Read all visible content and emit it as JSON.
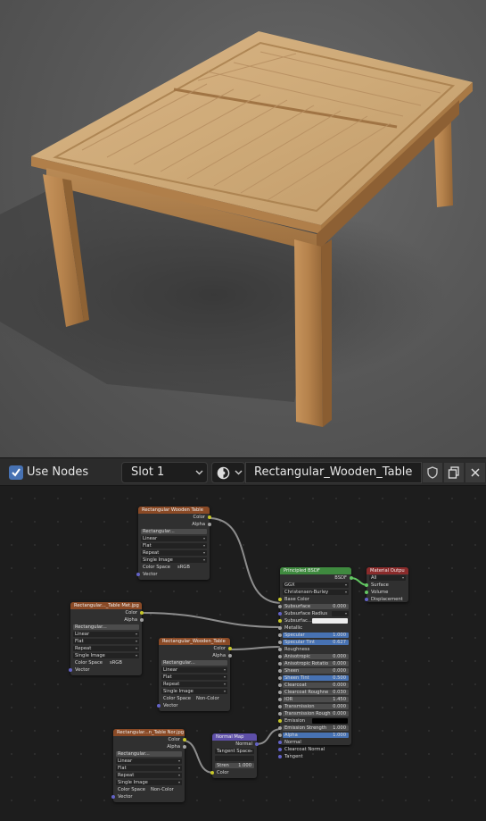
{
  "header": {
    "use_nodes_label": "Use Nodes",
    "use_nodes_checked": true,
    "slot_label": "Slot 1",
    "material_name": "Rectangular_Wooden_Table"
  },
  "colors": {
    "accent": "#4772b3",
    "image_node_header": "#8a4a26",
    "bsdf_node_header": "#3f8a3f",
    "output_node_header": "#8a2b2b",
    "normal_map_header": "#5e4fa8"
  },
  "nodes": {
    "tex1": {
      "title": "Rectangular Wooden Table",
      "out_color": "Color",
      "out_alpha": "Alpha",
      "image": "Rectangular...",
      "interp": "Linear",
      "proj": "Flat",
      "ext": "Repeat",
      "source": "Single Image",
      "cs_label": "Color Space",
      "cs_value": "sRGB",
      "in_vector": "Vector"
    },
    "tex2": {
      "title": "Rectangular..._Table Met.jpg",
      "out_color": "Color",
      "out_alpha": "Alpha",
      "image": "Rectangular...",
      "interp": "Linear",
      "proj": "Flat",
      "ext": "Repeat",
      "source": "Single Image",
      "cs_label": "Color Space",
      "cs_value": "sRGB",
      "in_vector": "Vector"
    },
    "tex3": {
      "title": "Rectangular_Wooden_Table",
      "out_color": "Color",
      "out_alpha": "Alpha",
      "image": "Rectangular...",
      "interp": "Linear",
      "proj": "Flat",
      "ext": "Repeat",
      "source": "Single Image",
      "cs_label": "Color Space",
      "cs_value": "Non-Color",
      "in_vector": "Vector"
    },
    "tex4": {
      "title": "Rectangular...n_Table Nor.jpg",
      "out_color": "Color",
      "out_alpha": "Alpha",
      "image": "Rectangular...",
      "interp": "Linear",
      "proj": "Flat",
      "ext": "Repeat",
      "source": "Single Image",
      "cs_label": "Color Space",
      "cs_value": "Non-Color",
      "in_vector": "Vector"
    },
    "normal_map": {
      "title": "Normal Map",
      "out_normal": "Normal",
      "space": "Tangent Space",
      "strength_label": "Stren",
      "strength_value": "1.000",
      "in_color": "Color"
    },
    "bsdf": {
      "title": "Principled BSDF",
      "out_bsdf": "BSDF",
      "distribution": "GGX",
      "subsurface_method": "Christensen-Burley",
      "rows": [
        {
          "label": "Base Color",
          "kind": "socket"
        },
        {
          "label": "Subsurface",
          "value": "0.000",
          "kind": "field"
        },
        {
          "label": "Subsurface Radius",
          "kind": "dropdown"
        },
        {
          "label": "Subsurfac...",
          "kind": "color"
        },
        {
          "label": "Metallic",
          "kind": "socket"
        },
        {
          "label": "Specular",
          "value": "1.000",
          "kind": "blue"
        },
        {
          "label": "Specular Tint",
          "value": "0.627",
          "kind": "blue"
        },
        {
          "label": "Roughness",
          "kind": "socket"
        },
        {
          "label": "Anisotropic",
          "value": "0.000",
          "kind": "field"
        },
        {
          "label": "Anisotropic Rotatio",
          "value": "0.000",
          "kind": "field"
        },
        {
          "label": "Sheen",
          "value": "0.000",
          "kind": "field"
        },
        {
          "label": "Sheen Tint",
          "value": "0.500",
          "kind": "blue"
        },
        {
          "label": "Clearcoat",
          "value": "0.000",
          "kind": "field"
        },
        {
          "label": "Clearcoat Roughne",
          "value": "0.030",
          "kind": "field"
        },
        {
          "label": "IOR",
          "value": "1.450",
          "kind": "field"
        },
        {
          "label": "Transmission",
          "value": "0.000",
          "kind": "field"
        },
        {
          "label": "Transmission Rough",
          "value": "0.000",
          "kind": "field"
        },
        {
          "label": "Emission",
          "kind": "dark"
        },
        {
          "label": "Emission Strength",
          "value": "1.000",
          "kind": "field"
        },
        {
          "label": "Alpha",
          "value": "1.000",
          "kind": "blue"
        },
        {
          "label": "Normal",
          "kind": "socket"
        },
        {
          "label": "Clearcoat Normal",
          "kind": "socket"
        },
        {
          "label": "Tangent",
          "kind": "socket"
        }
      ]
    },
    "output": {
      "title": "Material Outpu",
      "target": "All",
      "in_surface": "Surface",
      "in_volume": "Volume",
      "in_displacement": "Displacement"
    }
  }
}
